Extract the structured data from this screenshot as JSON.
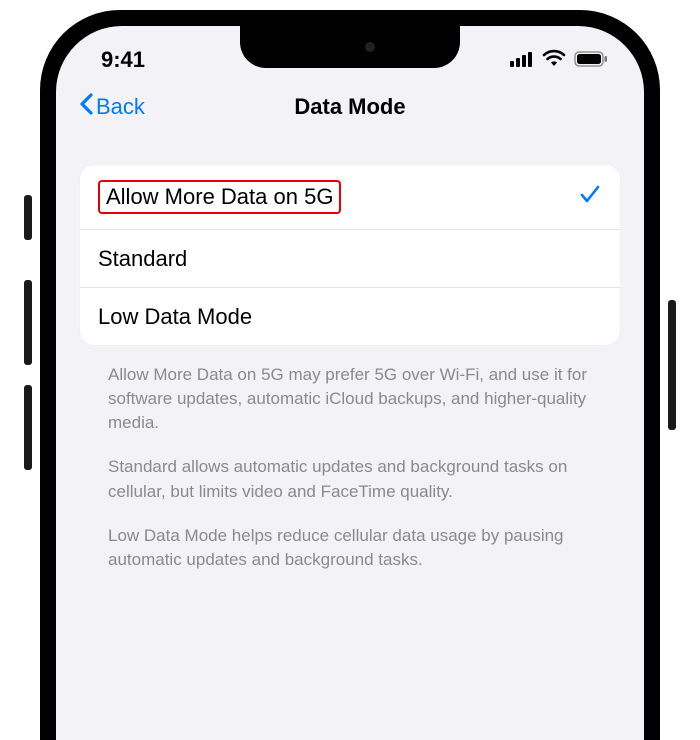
{
  "status": {
    "time": "9:41"
  },
  "nav": {
    "back_label": "Back",
    "title": "Data Mode"
  },
  "options": {
    "allow_more_5g": {
      "label": "Allow More Data on 5G",
      "selected": true
    },
    "standard": {
      "label": "Standard",
      "selected": false
    },
    "low_data": {
      "label": "Low Data Mode",
      "selected": false
    }
  },
  "footer": {
    "p1": "Allow More Data on 5G may prefer 5G over Wi-Fi, and use it for software updates, automatic iCloud backups, and higher-quality media.",
    "p2": "Standard allows automatic updates and background tasks on cellular, but limits video and FaceTime quality.",
    "p3": "Low Data Mode helps reduce cellular data usage by pausing automatic updates and background tasks."
  }
}
